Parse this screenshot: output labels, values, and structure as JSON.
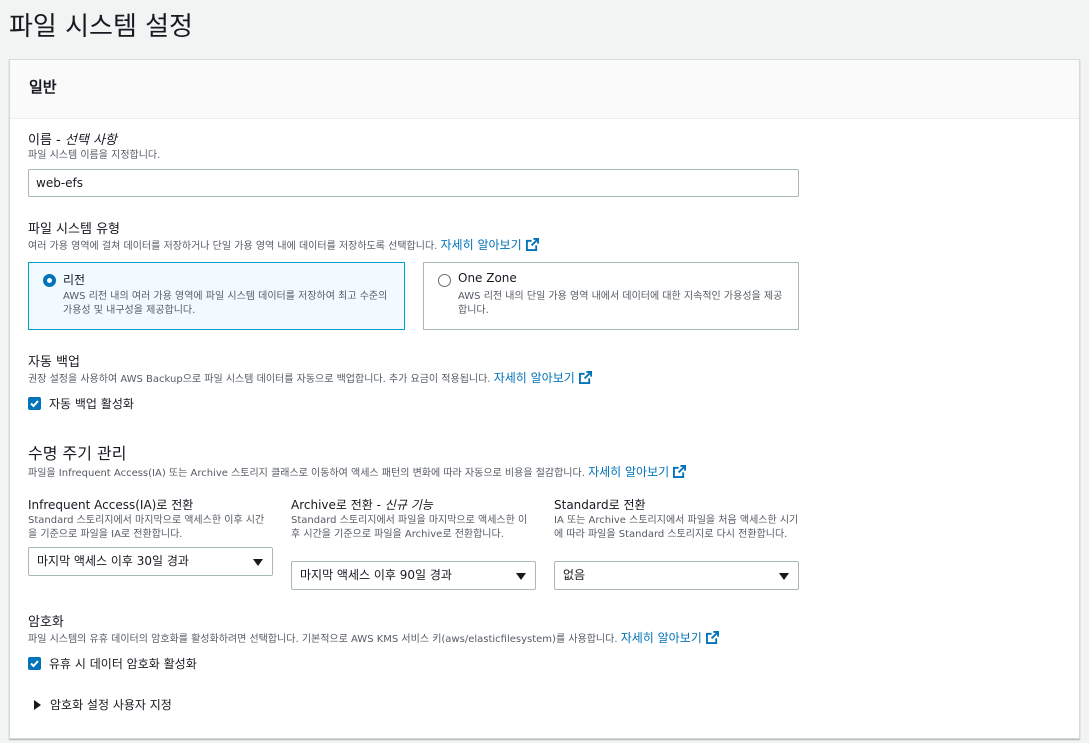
{
  "page": {
    "title": "파일 시스템 설정"
  },
  "panel": {
    "title": "일반"
  },
  "name": {
    "label": "이름 - ",
    "label_optional": "선택 사항",
    "description": "파일 시스템 이름을 지정합니다.",
    "value": "web-efs"
  },
  "fs_type": {
    "label": "파일 시스템 유형",
    "description": "여러 가용 영역에 걸쳐 데이터를 저장하거나 단일 가용 영역 내에 데이터를 저장하도록 선택합니다.",
    "link": "자세히 알아보기",
    "options": [
      {
        "title": "리전",
        "description": "AWS 리전 내의 여러 가용 영역에 파일 시스템 데이터를 저장하여 최고 수준의 가용성 및 내구성을 제공합니다.",
        "selected": true
      },
      {
        "title": "One Zone",
        "description": "AWS 리전 내의 단일 가용 영역 내에서 데이터에 대한 지속적인 가용성을 제공합니다.",
        "selected": false
      }
    ]
  },
  "backup": {
    "label": "자동 백업",
    "description": "권장 설정을 사용하여 AWS Backup으로 파일 시스템 데이터를 자동으로 백업합니다. 추가 요금이 적용됩니다.",
    "link": "자세히 알아보기",
    "checkbox_label": "자동 백업 활성화",
    "checked": true
  },
  "lifecycle": {
    "heading": "수명 주기 관리",
    "description": "파일을 Infrequent Access(IA) 또는 Archive 스토리지 클래스로 이동하여 액세스 패턴의 변화에 따라 자동으로 비용을 절감합니다.",
    "link": "자세히 알아보기",
    "columns": [
      {
        "title": "Infrequent Access(IA)로 전환",
        "title_suffix": "",
        "description": "Standard 스토리지에서 마지막으로 액세스한 이후 시간을 기준으로 파일을 IA로 전환합니다.",
        "value": "마지막 액세스 이후 30일 경과"
      },
      {
        "title": "Archive로 전환 - ",
        "title_suffix": "신규 기능",
        "description": "Standard 스토리지에서 파일을 마지막으로 액세스한 이후 시간을 기준으로 파일을 Archive로 전환합니다.",
        "value": "마지막 액세스 이후 90일 경과"
      },
      {
        "title": "Standard로 전환",
        "title_suffix": "",
        "description": "IA 또는 Archive 스토리지에서 파일을 처음 액세스한 시기에 따라 파일을 Standard 스토리지로 다시 전환합니다.",
        "value": "없음"
      }
    ]
  },
  "encryption": {
    "label": "암호화",
    "description": "파일 시스템의 유휴 데이터의 암호화를 활성화하려면 선택합니다. 기본적으로 AWS KMS 서비스 키(aws/elasticfilesystem)를 사용합니다.",
    "link": "자세히 알아보기",
    "checkbox_label": "유휴 시 데이터 암호화 활성화",
    "checked": true,
    "expander_label": "암호화 설정 사용자 지정"
  },
  "colors": {
    "link": "#0073bb",
    "selected_border": "#00a1c9",
    "selected_bg": "#f1faff"
  },
  "icons": {
    "external": "external-link-icon",
    "check": "check-icon",
    "caret": "caret-down-icon",
    "expand": "caret-right-icon"
  }
}
